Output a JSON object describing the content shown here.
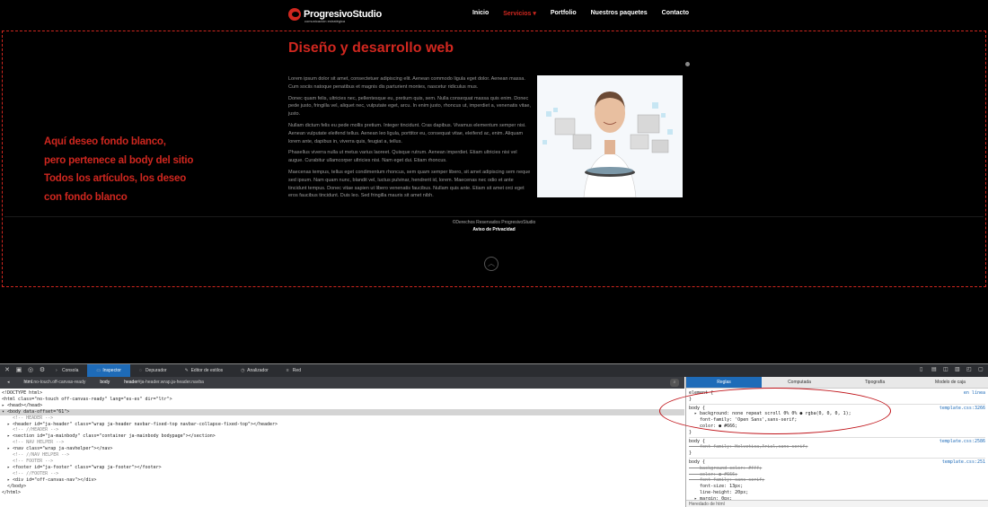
{
  "site": {
    "logo_text": "ProgresivoStudio",
    "logo_tagline": "comunicación estratégica",
    "nav": [
      {
        "label": "Inicio"
      },
      {
        "label": "Servicios ▾",
        "active": true
      },
      {
        "label": "Portfolio"
      },
      {
        "label": "Nuestros paquetes"
      },
      {
        "label": "Contacto"
      }
    ],
    "page_title": "Diseño y desarrollo web",
    "paragraphs": [
      "Lorem ipsum dolor sit amet, consectetuer adipiscing elit. Aenean commodo ligula eget dolor. Aenean massa. Cum sociis natoque penatibus et magnis dis parturient montes, nascetur ridiculus mus.",
      "Donec quam felis, ultricies nec, pellentesque eu, pretium quis, sem. Nulla consequat massa quis enim. Donec pede justo, fringilla vel, aliquet nec, vulputate eget, arcu. In enim justo, rhoncus ut, imperdiet a, venenatis vitae, justo.",
      "Nullam dictum felis eu pede mollis pretium. Integer tincidunt. Cras dapibus. Vivamus elementum semper nisi. Aenean vulputate eleifend tellus. Aenean leo ligula, porttitor eu, consequat vitae, eleifend ac, enim. Aliquam lorem ante, dapibus in, viverra quis, feugiat a, tellus.",
      "Phasellus viverra nulla ut metus varius laoreet. Quisque rutrum. Aenean imperdiet. Etiam ultricies nisi vel augue. Curabitur ullamcorper ultricies nisi. Nam eget dui. Etiam rhoncus.",
      "Maecenas tempus, tellus eget condimentum rhoncus, sem quam semper libero, sit amet adipiscing sem neque sed ipsum. Nam quam nunc, blandit vel, luctus pulvinar, hendrerit id, lorem. Maecenas nec odio et ante tincidunt tempus. Donec vitae sapien ut libero venenatis faucibus. Nullam quis ante. Etiam sit amet orci eget eros faucibus tincidunt. Duis leo. Sed fringilla mauris sit amet nibh."
    ],
    "annotation_lines": [
      "Aquí deseo fondo blanco,",
      "pero pertenece  al body del sitio",
      "Todos los artículos, los deseo",
      "con fondo blanco"
    ],
    "copyright": "©Derechos Reservados ProgresivoStudio",
    "privacy_link": "Aviso de Privacidad",
    "back_to_top_icon": "chevron-up-icon",
    "accent_color": "#d0271f"
  },
  "devtools": {
    "tabs": [
      {
        "label": "Consola",
        "icon": "console-icon"
      },
      {
        "label": "Inspector",
        "icon": "inspector-icon",
        "active": true
      },
      {
        "label": "Depurador",
        "icon": "debugger-icon"
      },
      {
        "label": "Editor de estilos",
        "icon": "style-editor-icon"
      },
      {
        "label": "Analizador",
        "icon": "profiler-icon"
      },
      {
        "label": "Red",
        "icon": "network-icon"
      }
    ],
    "breadcrumbs": [
      {
        "tag": "html",
        "rest": ".no-touch.off-canvas-ready"
      },
      {
        "tag": "body",
        "rest": ""
      },
      {
        "tag": "header",
        "rest": "#ja-header.wrap.ja-header.navba"
      }
    ],
    "dom_lines": [
      {
        "text": "<!DOCTYPE html>",
        "type": ""
      },
      {
        "text": "<html class=\"no-touch off-canvas-ready\" lang=\"es-es\" dir=\"ltr\">",
        "type": ""
      },
      {
        "text": "▸ <head></head>",
        "type": ""
      },
      {
        "text": "▾ <body data-offset=\"61\">",
        "type": "sel"
      },
      {
        "text": "    <!-- HEADER -->",
        "type": "cm"
      },
      {
        "text": "  ▸ <header id=\"ja-header\" class=\"wrap ja-header navbar-fixed-top navbar-collapse-fixed-top\"></header>",
        "type": ""
      },
      {
        "text": "    <!-- //HEADER -->",
        "type": "cm"
      },
      {
        "text": "  ▸ <section id=\"ja-mainbody\" class=\"container ja-mainbody bodypage\"></section>",
        "type": ""
      },
      {
        "text": "    <!-- NAV HELPER -->",
        "type": "cm"
      },
      {
        "text": "  ▸ <nav class=\"wrap ja-navhelper\"></nav>",
        "type": ""
      },
      {
        "text": "    <!-- //NAV HELPER -->",
        "type": "cm"
      },
      {
        "text": "    <!-- FOOTER -->",
        "type": "cm"
      },
      {
        "text": "  ▸ <footer id=\"ja-footer\" class=\"wrap ja-footer\"></footer>",
        "type": ""
      },
      {
        "text": "    <!-- //FOOTER -->",
        "type": "cm"
      },
      {
        "text": "  ▸ <div id=\"off-canvas-nav\"></div>",
        "type": ""
      },
      {
        "text": "  </body>",
        "type": ""
      },
      {
        "text": "</html>",
        "type": ""
      }
    ],
    "rules_tabs": [
      {
        "label": "Reglas",
        "active": true
      },
      {
        "label": "Computada"
      },
      {
        "label": "Tipografía"
      },
      {
        "label": "Modelo de caja"
      }
    ],
    "rules": [
      {
        "text": "element {",
        "src": "en línea",
        "strike": false
      },
      {
        "text": "}",
        "src": "",
        "strike": false
      },
      {
        "sep": true
      },
      {
        "text": "body {",
        "src": "template.css:3266",
        "strike": false
      },
      {
        "text": "  ▸ background: none repeat scroll 0% 0% ● rgba(0, 0, 0, 1);",
        "src": "",
        "strike": false
      },
      {
        "text": "    font-family: 'Open Sans',sans-serif;",
        "src": "",
        "strike": false
      },
      {
        "text": "    color: ● #666;",
        "src": "",
        "strike": false
      },
      {
        "text": "}",
        "src": "",
        "strike": false
      },
      {
        "sep": true
      },
      {
        "text": "body {",
        "src": "template.css:2586",
        "strike": false
      },
      {
        "text": "    font-family: Helvetica,Arial,sans-serif;",
        "src": "",
        "strike": true
      },
      {
        "text": "}",
        "src": "",
        "strike": false
      },
      {
        "sep": true
      },
      {
        "text": "body {",
        "src": "template.css:251",
        "strike": false
      },
      {
        "text": "    background-color: #fff;",
        "src": "",
        "strike": true
      },
      {
        "text": "    color: ● #666;",
        "src": "",
        "strike": true
      },
      {
        "text": "    font-family: sans-serif;",
        "src": "",
        "strike": true
      },
      {
        "text": "    font-size: 13px;",
        "src": "",
        "strike": false
      },
      {
        "text": "    line-height: 20px;",
        "src": "",
        "strike": false
      },
      {
        "text": "  ▸ margin: 0px;",
        "src": "",
        "strike": false
      },
      {
        "text": "}",
        "src": "",
        "strike": false
      }
    ],
    "status": "Heredado de html"
  }
}
